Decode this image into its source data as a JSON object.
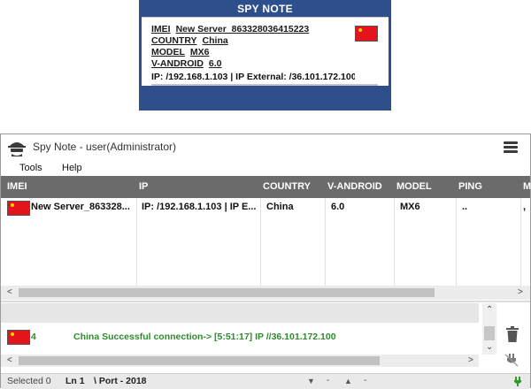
{
  "popup": {
    "title": "SPY NOTE",
    "imei_key": "IMEI",
    "imei_val": "New Server_863328036415223",
    "country_key": "COUNTRY",
    "country_val": "China",
    "model_key": "MODEL",
    "model_val": "MX6",
    "android_key": "V-ANDROID",
    "android_val": "6.0",
    "ip_line": "IP: /192.168.1.103 | IP External: /36.101.172.100",
    "flag_icon": "china-flag-icon"
  },
  "window": {
    "title": "Spy Note - user(Administrator)",
    "menu": [
      "Tools",
      "Help"
    ]
  },
  "grid": {
    "headers": [
      "IMEI",
      "IP",
      "COUNTRY",
      "V-ANDROID",
      "MODEL",
      "PING",
      "M"
    ],
    "row": {
      "imei": "New Server_863328...",
      "ip": "IP: /192.168.1.103 | IP E...",
      "country": "China",
      "android": "6.0",
      "model": "MX6",
      "ping": "..",
      "extra": ","
    }
  },
  "log": {
    "num": "4",
    "message": "China  Successful connection->  [5:51:17] IP //36.101.172.100"
  },
  "status": {
    "selected": "Selected 0",
    "line": "Ln 1",
    "port": "\\ Port - 2018",
    "sep1": "-",
    "sep2": "-"
  },
  "colors": {
    "popup_bg": "#2e4f8b",
    "header_bg": "#6b6b6b",
    "log_text": "#2e8b2e",
    "flag_red": "#e3141c"
  }
}
